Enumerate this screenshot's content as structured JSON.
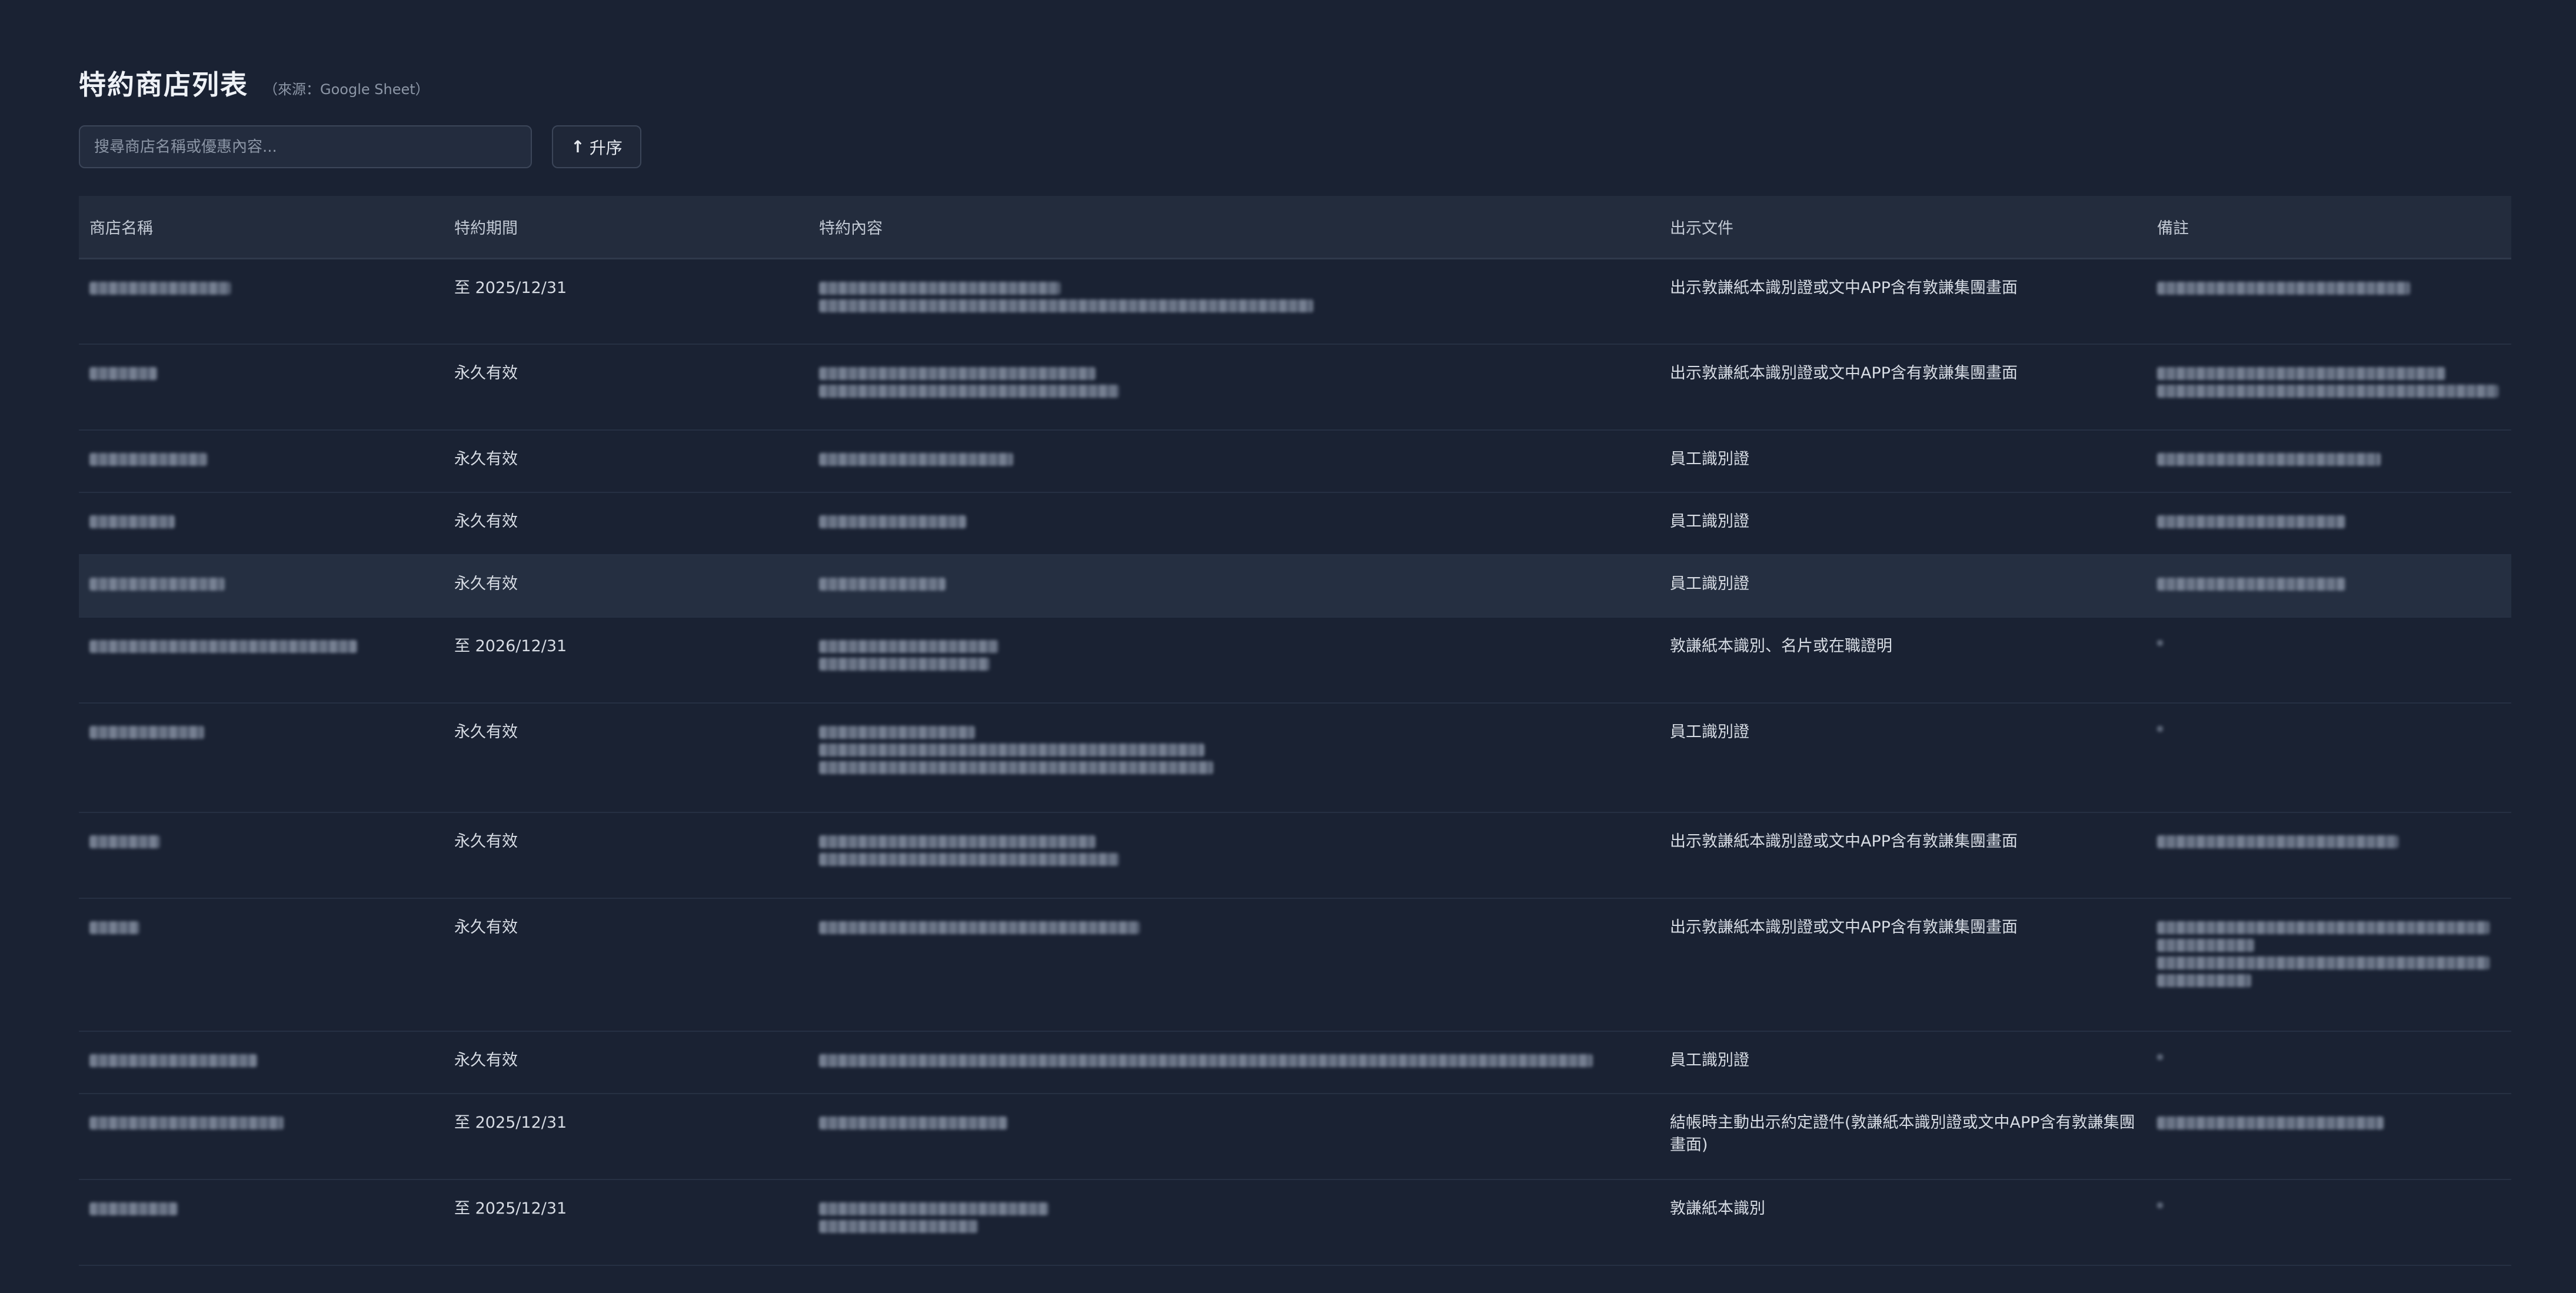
{
  "header": {
    "title": "特約商店列表",
    "source_label": "（來源：Google Sheet）"
  },
  "search": {
    "placeholder": "搜尋商店名稱或優惠內容..."
  },
  "sort_button": {
    "icon": "arrow-up-icon",
    "label": "升序"
  },
  "table": {
    "columns": [
      "商店名稱",
      "特約期間",
      "特約內容",
      "出示文件",
      "備註"
    ],
    "rows": [
      {
        "period": "至 2025/12/31",
        "document": "出示敦謙紙本識別證或文中APP含有敦謙集團畫面"
      },
      {
        "period": "永久有效",
        "document": "出示敦謙紙本識別證或文中APP含有敦謙集團畫面"
      },
      {
        "period": "永久有效",
        "document": "員工識別證"
      },
      {
        "period": "永久有效",
        "document": "員工識別證"
      },
      {
        "period": "永久有效",
        "document": "員工識別證"
      },
      {
        "period": "至 2026/12/31",
        "document": "敦謙紙本識別、名片或在職證明"
      },
      {
        "period": "永久有效",
        "document": "員工識別證"
      },
      {
        "period": "永久有效",
        "document": "出示敦謙紙本識別證或文中APP含有敦謙集團畫面"
      },
      {
        "period": "永久有效",
        "document": "出示敦謙紙本識別證或文中APP含有敦謙集團畫面"
      },
      {
        "period": "永久有效",
        "document": "員工識別證"
      },
      {
        "period": "至 2025/12/31",
        "document": "結帳時主動出示約定證件(敦謙紙本識別證或文中APP含有敦謙集團畫面)"
      },
      {
        "period": "至 2025/12/31",
        "document": "敦謙紙本識別"
      }
    ]
  }
}
